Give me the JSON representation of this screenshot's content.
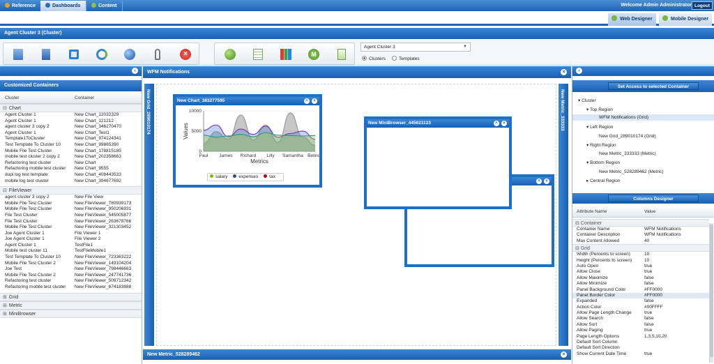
{
  "topbar": {
    "tabs": [
      {
        "label": "Reference"
      },
      {
        "label": "Dashboards"
      },
      {
        "label": "Content"
      }
    ],
    "welcome": "Welcome Admin Administrator",
    "logout": "Logout"
  },
  "designer": {
    "web": "Web Designer",
    "mobile": "Mobile Designer"
  },
  "cluster_title": "Agent Cluster 3 (Cluster)",
  "toolbar": {
    "select_value": "Agent Cluster 3",
    "radio_clusters": "Clusters",
    "radio_templates": "Templates"
  },
  "left": {
    "title": "Customized Containers",
    "col_cluster": "Cluster",
    "col_container": "Container",
    "sections": [
      {
        "name": "Chart",
        "rows": [
          [
            "Agent Cluster 1",
            "New Chart_12032329"
          ],
          [
            "Agent Cluster 1",
            "New Chart_121212"
          ],
          [
            "agent cluster 3 copy 2",
            "New Chart_346270470"
          ],
          [
            "Agent Cluster 1",
            "New Chart_Test1"
          ],
          [
            "Template1ToCluster",
            "New Chart_974124341"
          ],
          [
            "Test Template To Cluster 10",
            "New Chart_99865390"
          ],
          [
            "Mobile File Test Cluster",
            "New Chart_178815185"
          ],
          [
            "mobile test cluster 2 copy 2",
            "New Chart_202358663"
          ],
          [
            "Refactoring test cluster",
            "New Chart"
          ],
          [
            "Refactoring mobile test cluster",
            "New Chart_9555"
          ],
          [
            "dupl log test template",
            "New Chart_408443533"
          ],
          [
            "mobile log test cluster",
            "New Chart_394677692"
          ]
        ]
      },
      {
        "name": "FileViewer",
        "rows": [
          [
            "agent cluster 3 copy 2",
            "New File View"
          ],
          [
            "Mobile File Test Cluster",
            "New FileViewer_780939173"
          ],
          [
            "Mobile File Test Cluster",
            "New FileViewer_950206931"
          ],
          [
            "File Test Cluster",
            "New FileViewer_545005877"
          ],
          [
            "File Test Cluster",
            "New FileViewer_263678766"
          ],
          [
            "Mobile File Test Cluster",
            "New FileViewer_321303452"
          ],
          [
            "Joe Agent Cluster 1",
            "File Viewer 1"
          ],
          [
            "Joe Agent Cluster 1",
            "File Viewer 2"
          ],
          [
            "Agent Cluster 1",
            "TestFile1"
          ],
          [
            "Mobile test cluster 11",
            "TestFileMobile1"
          ],
          [
            "Test Template To Cluster 10",
            "New FileViewer_723363222"
          ],
          [
            "Mobile File Test Cluster 2",
            "New FileViewer_149104204"
          ],
          [
            "Joe Test",
            "New FileViewer_798446663"
          ],
          [
            "Mobile File Test Cluster 2",
            "New FileViewer_247741736"
          ],
          [
            "Refactoring test cluster",
            "New FileViewer_509712342"
          ],
          [
            "Refactoring mobile test cluster",
            "New FileViewer_674183888"
          ]
        ]
      },
      {
        "name": "Grid",
        "rows": []
      },
      {
        "name": "Metric",
        "rows": []
      },
      {
        "name": "MiniBrowser",
        "rows": []
      }
    ]
  },
  "center": {
    "title": "WFM Notifications",
    "grid_left": "New Grid_289010174",
    "metric_right": "New Metric_333333",
    "metric_bottom": "New Metric_528289462",
    "minibrowser": "New MiniBrowser_445621123",
    "chart_window": "New Chart_383277595"
  },
  "chart_data": {
    "type": "area",
    "x": [
      "Paul",
      "James",
      "Richard",
      "Lilly",
      "Samantha",
      "Belinda"
    ],
    "xlabel": "Metrics",
    "ylabel": "Values",
    "yticks": [
      "10000",
      "5000",
      "0"
    ],
    "ylim": [
      0,
      10000
    ],
    "series": [
      {
        "name": "salary",
        "color": "#7fb800",
        "values": [
          4000,
          3500,
          3800,
          4200,
          3600,
          4600,
          4000,
          3900,
          3800,
          3900
        ]
      },
      {
        "name": "expenses",
        "color": "#2c4aa0",
        "values": [
          5200,
          6500,
          3600,
          5500,
          4200,
          6200,
          3500,
          4400,
          5000,
          3000
        ]
      },
      {
        "name": "tax",
        "color": "#a01010",
        "values": [
          2000,
          4800,
          3000,
          9000,
          2800,
          6500,
          2200,
          9500,
          3500,
          1500
        ]
      }
    ],
    "legend": "bottom"
  },
  "right": {
    "access_btn": "Set Access to selected Container",
    "tree": {
      "root": "Cluster",
      "top": "Top Region",
      "top_child": "WFM Notifications (Grid)",
      "left": "Left Region",
      "left_child": "New Grid_289010174 (Grid)",
      "rightr": "Right Region",
      "right_child": "New Metric_333333 (Metric)",
      "bottom": "Bottom Region",
      "bottom_child": "New Metric_528289462 (Metric)",
      "central": "Central Region"
    },
    "columns_btn": "Columns Designer",
    "col_attr": "Attribute Name",
    "col_value": "Value",
    "sections": [
      {
        "name": "Container",
        "rows": [
          [
            "Container Name",
            "WFM Notifications"
          ],
          [
            "Container Description",
            "WFM Notifications"
          ],
          [
            "Max Content Allowed",
            "40"
          ]
        ]
      },
      {
        "name": "Grid",
        "rows": [
          [
            "Width (Percents to screen)",
            "10"
          ],
          [
            "Height (Percents to screen)",
            "10"
          ],
          [
            "Auto Open",
            "true"
          ],
          [
            "Allow Close",
            "true"
          ],
          [
            "Allow Maximize",
            "false"
          ],
          [
            "Allow Minimize",
            "false"
          ],
          [
            "Panel Background Color",
            "#FF0000"
          ],
          [
            "Panel Border Color",
            "#FF0000"
          ],
          [
            "Expanded",
            "false"
          ],
          [
            "Action Color",
            "#00FFFF"
          ],
          [
            "Allow Page Length Change",
            "true"
          ],
          [
            "Allow Search",
            "false"
          ],
          [
            "Allow Sort",
            "false"
          ],
          [
            "Allow Paging",
            "true"
          ],
          [
            "Page Length Options",
            "1,3,5,10,20"
          ],
          [
            "Default Sort Column",
            ""
          ],
          [
            "Default Sort Direction",
            ""
          ],
          [
            "Show Current Date Time",
            "true"
          ]
        ]
      }
    ]
  }
}
